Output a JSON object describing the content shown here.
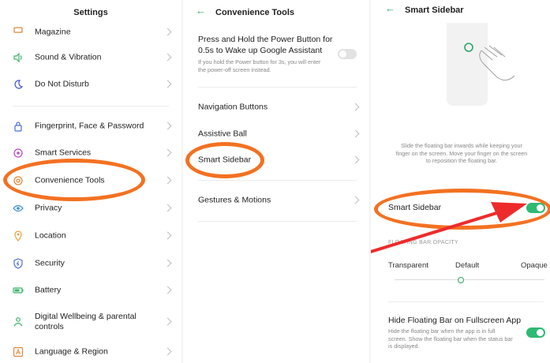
{
  "colors": {
    "accent": "#2aa66a",
    "toggle_on": "#2fba73",
    "highlight": "#f37121",
    "arrow": "#ee2b2b"
  },
  "settings": {
    "title": "Settings",
    "items": [
      {
        "label": "Magazine",
        "icon": "magazine-icon"
      },
      {
        "label": "Sound & Vibration",
        "icon": "sound-icon"
      },
      {
        "label": "Do Not Disturb",
        "icon": "moon-icon"
      },
      {
        "label": "Fingerprint, Face & Password",
        "icon": "lock-icon"
      },
      {
        "label": "Smart Services",
        "icon": "smart-services-icon"
      },
      {
        "label": "Convenience Tools",
        "icon": "convenience-tools-icon"
      },
      {
        "label": "Privacy",
        "icon": "privacy-icon"
      },
      {
        "label": "Location",
        "icon": "location-pin-icon"
      },
      {
        "label": "Security",
        "icon": "shield-icon"
      },
      {
        "label": "Battery",
        "icon": "battery-icon"
      },
      {
        "label": "Digital Wellbeing & parental controls",
        "icon": "wellbeing-icon"
      },
      {
        "label": "Language & Region",
        "icon": "language-icon"
      }
    ]
  },
  "convenience": {
    "title": "Convenience Tools",
    "power": {
      "title": "Press and Hold the Power Button for 0.5s to Wake up Google Assistant",
      "desc": "If you hold the Power button for 3s, you will enter the power-off screen instead."
    },
    "items": [
      {
        "label": "Navigation Buttons"
      },
      {
        "label": "Assistive Ball"
      },
      {
        "label": "Smart Sidebar"
      },
      {
        "label": "Gestures & Motions"
      }
    ]
  },
  "sidebar": {
    "title": "Smart Sidebar",
    "desc": "Slide the floating bar inwards while keeping your finger on the screen. Move your finger on the screen to reposition the floating bar.",
    "toggle_label": "Smart Sidebar",
    "opacity_heading": "FLOATING BAR OPACITY",
    "opacity_labels": {
      "left": "Transparent",
      "mid": "Default",
      "right": "Opaque"
    },
    "hide": {
      "title": "Hide Floating Bar on Fullscreen App",
      "desc": "Hide the floating bar when the app is in full screen. Show the floating bar when the status bar is displayed."
    }
  }
}
